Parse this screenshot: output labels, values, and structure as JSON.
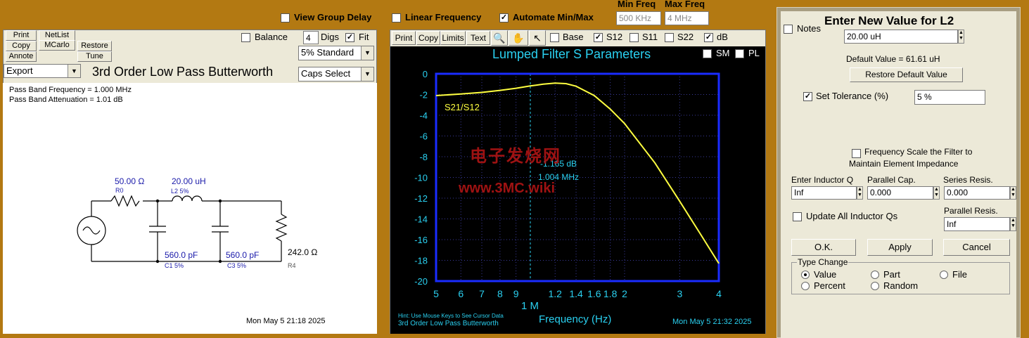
{
  "top_bar": {
    "view_group_delay": "View Group Delay",
    "linear_frequency": "Linear Frequency",
    "automate": "Automate Min/Max",
    "min_freq_label": "Min Freq",
    "max_freq_label": "Max Freq",
    "min_freq_value": "500 KHz",
    "max_freq_value": "4 MHz"
  },
  "left_panel": {
    "buttons": {
      "print": "Print",
      "netlist": "NetList",
      "copy": "Copy",
      "mcarlo": "MCarlo",
      "restore": "Restore",
      "annote": "Annote",
      "tune": "Tune"
    },
    "balance": "Balance",
    "digs_value": "4",
    "digs": "Digs",
    "fit": "Fit",
    "standard": "5% Standard",
    "export": "Export",
    "caps_select": "Caps Select",
    "title": "3rd Order Low Pass Butterworth",
    "info1": "Pass Band Frequency = 1.000 MHz",
    "info2": "Pass Band Attenuation = 1.01 dB",
    "r0_value": "50.00 Ω",
    "r0_name": "R0",
    "l2_value": "20.00 uH",
    "l2_name": "L2 5%",
    "c1_value": "560.0 pF",
    "c1_name": "C1 5%",
    "c3_value": "560.0 pF",
    "c3_name": "C3 5%",
    "r4_value": "242.0 Ω",
    "r4_name": "R4",
    "timestamp": "Mon May  5 21:18 2025"
  },
  "graph_toolbar": {
    "print": "Print",
    "copy": "Copy",
    "limits": "Limits",
    "text": "Text",
    "base": "Base",
    "s12": "S12",
    "s11": "S11",
    "s22": "S22",
    "db": "dB",
    "sm": "SM",
    "pl": "PL"
  },
  "graph": {
    "title": "Lumped Filter S Parameters",
    "trace_label": "S21/S12",
    "cursor_db": "-1.165 dB",
    "cursor_freq": "1.004 MHz",
    "xlabel": "Frequency (Hz)",
    "x_major_label": "1 M",
    "hint": "Hint: Use Mouse Keys to See Cursor Data",
    "subtitle": "3rd Order Low Pass Butterworth",
    "timestamp": "Mon May  5 21:32 2025",
    "watermark1": "电子发烧网",
    "watermark2": "www.3MC.wiki"
  },
  "chart_data": {
    "type": "line",
    "title": "Lumped Filter S Parameters",
    "xlabel": "Frequency (Hz)",
    "ylabel": "",
    "x_scale": "log",
    "xlim": [
      500000,
      4000000
    ],
    "ylim": [
      -20,
      0
    ],
    "x_tick_labels": [
      "5",
      "6",
      "7",
      "8",
      "9",
      "1.2",
      "1.4",
      "1.6",
      "1.8",
      "2",
      "3",
      "4"
    ],
    "y_tick_labels": [
      "0",
      "-2",
      "-4",
      "-6",
      "-8",
      "-10",
      "-12",
      "-14",
      "-16",
      "-18",
      "-20"
    ],
    "grid": true,
    "series": [
      {
        "name": "S21/S12",
        "color": "#ffff40",
        "x": [
          500000,
          600000,
          700000,
          800000,
          900000,
          1000000,
          1100000,
          1200000,
          1300000,
          1400000,
          1600000,
          1800000,
          2000000,
          2500000,
          3000000,
          3500000,
          4000000
        ],
        "y": [
          -2.1,
          -1.95,
          -1.8,
          -1.6,
          -1.4,
          -1.17,
          -1.0,
          -0.9,
          -0.95,
          -1.2,
          -2.1,
          -3.4,
          -4.8,
          -8.6,
          -12.3,
          -15.5,
          -18.3
        ]
      }
    ],
    "cursor": {
      "x": 1004000,
      "y": -1.165
    }
  },
  "right_panel": {
    "notes": "Notes",
    "heading": "Enter New Value for L2",
    "value": "20.00 uH",
    "default_value": "Default Value = 61.61 uH",
    "restore_default": "Restore Default Value",
    "set_tolerance": "Set Tolerance (%)",
    "tolerance_value": "5 %",
    "freq_scale_1": "Frequency Scale the Filter to",
    "freq_scale_2": "Maintain Element Impedance",
    "inductor_q_label": "Enter Inductor Q",
    "inductor_q_value": "Inf",
    "parallel_cap_label": "Parallel Cap.",
    "parallel_cap_value": "0.000",
    "series_resis_label": "Series Resis.",
    "series_resis_value": "0.000",
    "update_all": "Update All Inductor Qs",
    "parallel_resis_label": "Parallel Resis.",
    "parallel_resis_value": "Inf",
    "ok": "O.K.",
    "apply": "Apply",
    "cancel": "Cancel",
    "type_change": "Type Change",
    "opt_value": "Value",
    "opt_part": "Part",
    "opt_file": "File",
    "opt_percent": "Percent",
    "opt_random": "Random"
  }
}
